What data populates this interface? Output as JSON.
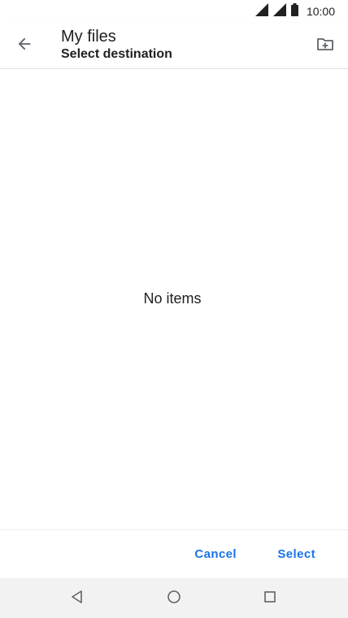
{
  "status_bar": {
    "time": "10:00",
    "icons": [
      "cell-signal-icon",
      "cell-signal-icon",
      "battery-icon"
    ]
  },
  "app_bar": {
    "back_icon": "arrow-back-icon",
    "title": "My files",
    "subtitle": "Select destination",
    "action_icon": "new-folder-icon"
  },
  "content": {
    "empty_message": "No items"
  },
  "actions": {
    "cancel_label": "Cancel",
    "select_label": "Select"
  },
  "nav_bar": {
    "icons": [
      "nav-back-icon",
      "nav-home-icon",
      "nav-recents-icon"
    ]
  },
  "colors": {
    "accent": "#1a73e8",
    "text_primary": "#212121",
    "icon_gray": "#5f6368",
    "nav_bar_bg": "#f2f2f2"
  }
}
